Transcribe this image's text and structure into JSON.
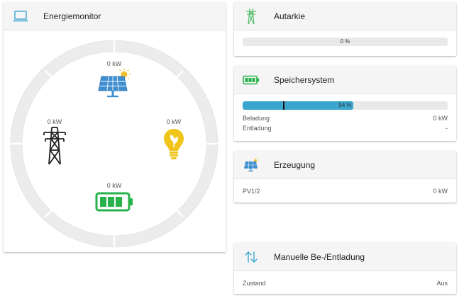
{
  "monitor": {
    "title": "Energiemonitor",
    "solar": {
      "value": "0 kW"
    },
    "grid": {
      "value": "0 kW"
    },
    "consumption": {
      "value": "0 kW"
    },
    "battery": {
      "value": "0 kW"
    }
  },
  "autarkie": {
    "title": "Autarkie",
    "progress_label": "0 %",
    "progress_fraction": 0
  },
  "speicher": {
    "title": "Speichersystem",
    "progress_label": "54 %",
    "progress_fraction": 0.54,
    "rows": [
      {
        "label": "Beladung",
        "value": "0 kW"
      },
      {
        "label": "Entladung",
        "value": "-"
      }
    ]
  },
  "erzeugung": {
    "title": "Erzeugung",
    "rows": [
      {
        "label": "PV1/2",
        "value": "0 kW"
      }
    ]
  },
  "manuell": {
    "title": "Manuelle Be-/Entladung",
    "rows": [
      {
        "label": "Zustand",
        "value": "Aus"
      }
    ]
  },
  "colors": {
    "accent_blue": "#3aa6d0",
    "solar_blue": "#3e8ed0",
    "sun_yellow": "#f2c12e",
    "bulb_yellow": "#f0c419",
    "battery_green": "#27b24a",
    "tower_green": "#5cbf72",
    "ring_gray": "#ececec"
  },
  "icons": {
    "monitor": "laptop-icon",
    "autarkie": "power-tower-icon",
    "speicher": "battery-icon",
    "erzeugung": "solar-panel-icon",
    "manuell": "up-down-arrows-icon"
  }
}
